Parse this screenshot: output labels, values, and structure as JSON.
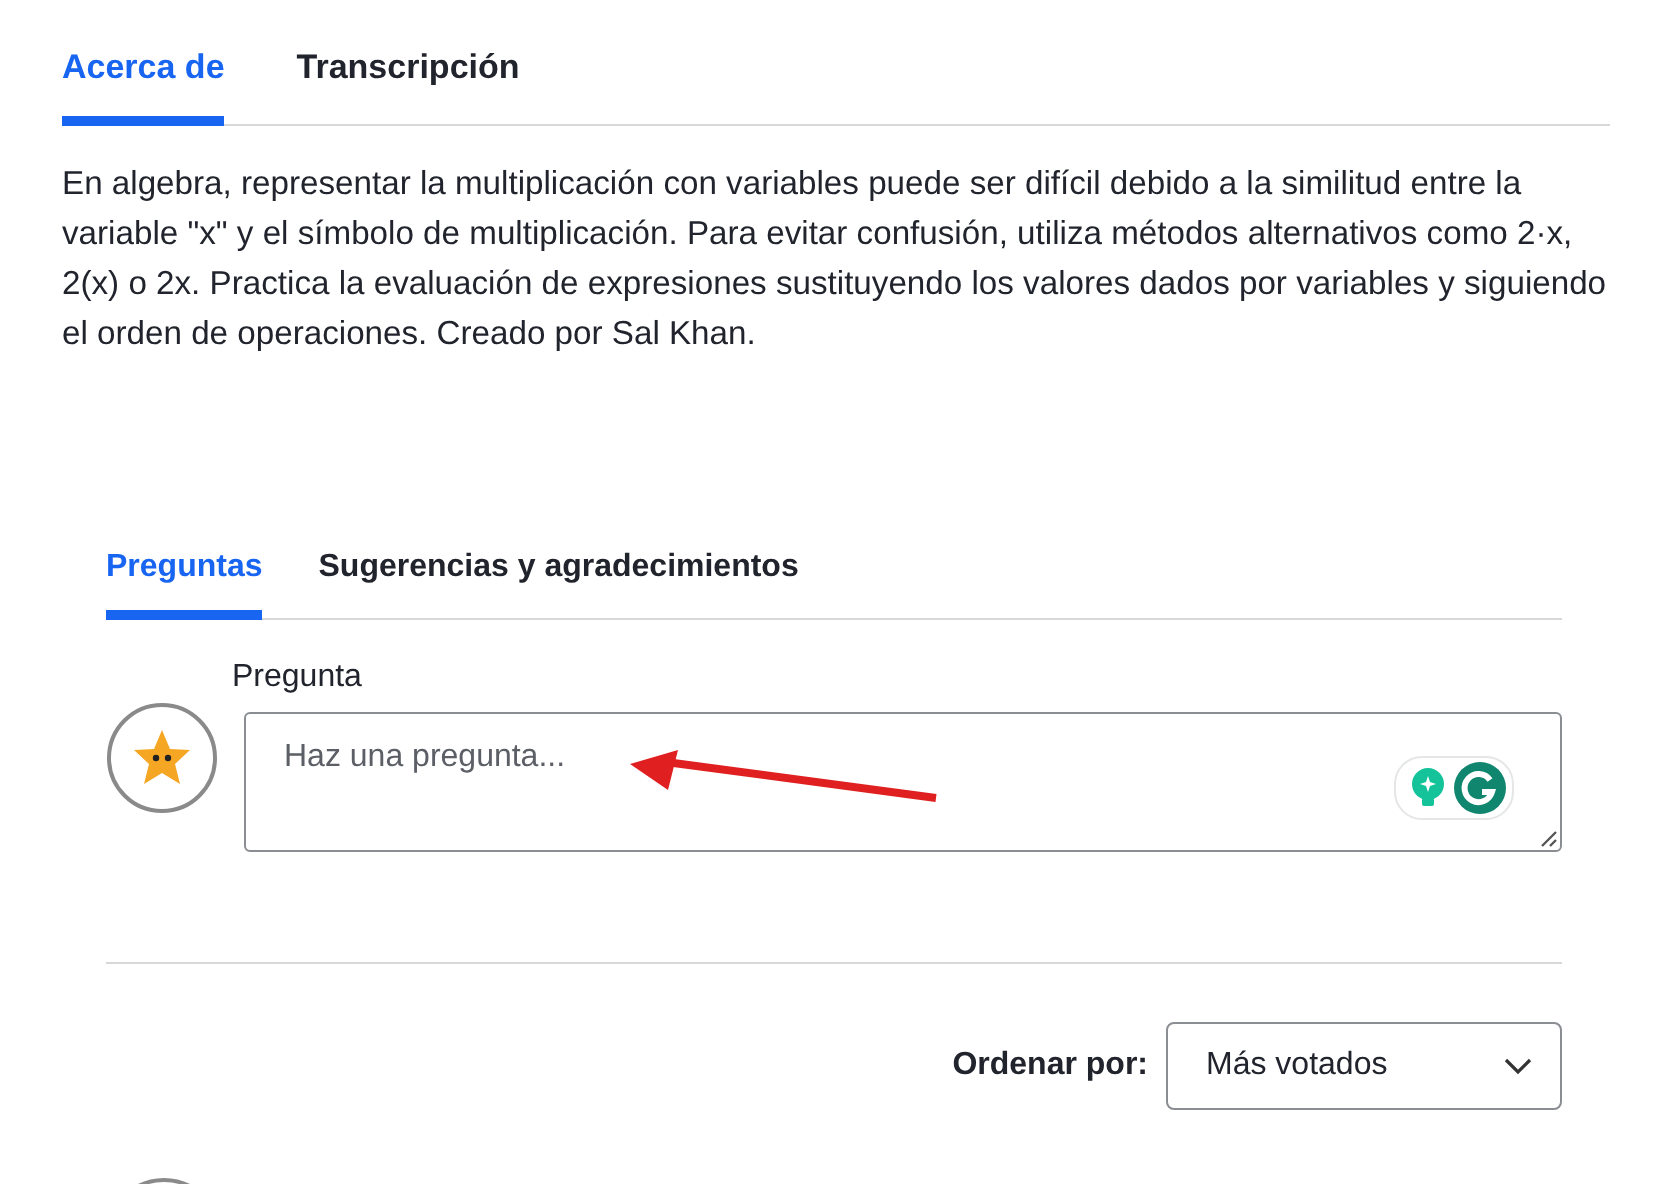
{
  "tabs": [
    {
      "label": "Acerca de",
      "selected": true
    },
    {
      "label": "Transcripción",
      "selected": false
    }
  ],
  "description": "En algebra, representar la multiplicación con variables puede ser difícil debido a la similitud entre la variable \"x\" y el símbolo de multiplicación. Para evitar confusión, utiliza métodos alternativos como 2·x, 2(x) o 2x. Practica la evaluación de expresiones sustituyendo los valores dados por variables y siguiendo el orden de operaciones. Creado por Sal Khan.",
  "discussion_tabs": [
    {
      "label": "Preguntas",
      "selected": true
    },
    {
      "label": "Sugerencias y agradecimientos",
      "selected": false
    }
  ],
  "question": {
    "label": "Pregunta",
    "placeholder": "Haz una pregunta..."
  },
  "sort": {
    "label": "Ordenar por:",
    "value": "Más votados"
  }
}
